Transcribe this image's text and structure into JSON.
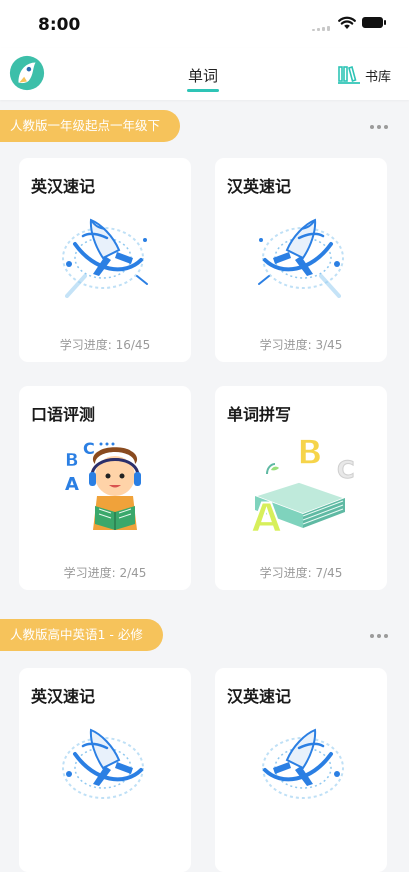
{
  "status_bar": {
    "time": "8:00"
  },
  "header": {
    "tab_label": "单词",
    "library_label": "书库"
  },
  "sections": [
    {
      "label": "人教版一年级起点一年级下",
      "cards": [
        {
          "title": "英汉速记",
          "progress": "学习进度: 16/45",
          "icon": "rocket-icon"
        },
        {
          "title": "汉英速记",
          "progress": "学习进度: 3/45",
          "icon": "rocket-icon"
        },
        {
          "title": "口语评测",
          "progress": "学习进度: 2/45",
          "icon": "headphone-boy-icon"
        },
        {
          "title": "单词拼写",
          "progress": "学习进度: 7/45",
          "icon": "abc-book-icon"
        }
      ]
    },
    {
      "label": "人教版高中英语1 - 必修",
      "cards": [
        {
          "title": "英汉速记",
          "icon": "rocket-icon"
        },
        {
          "title": "汉英速记",
          "icon": "rocket-icon"
        }
      ]
    }
  ],
  "colors": {
    "accent": "#2ec4b6",
    "section_label_bg": "#f6c35b",
    "rocket_blue": "#2b7fe3"
  }
}
